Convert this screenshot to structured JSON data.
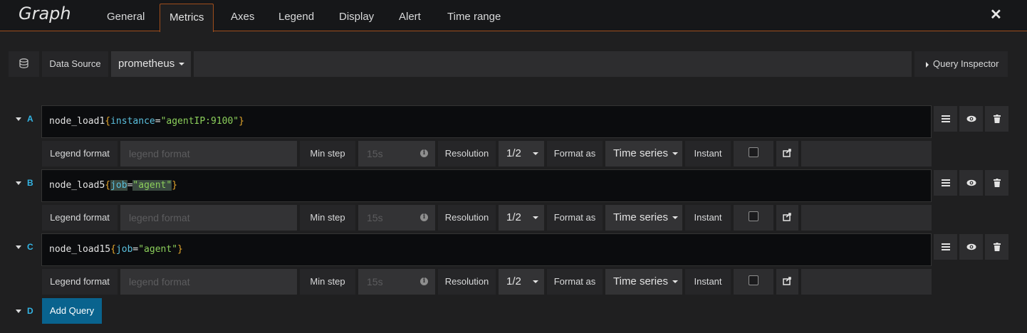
{
  "panel": {
    "title": "Graph",
    "tabs": [
      "General",
      "Metrics",
      "Axes",
      "Legend",
      "Display",
      "Alert",
      "Time range"
    ],
    "active_tab": "Metrics"
  },
  "datasource": {
    "label": "Data Source",
    "value": "prometheus",
    "inspector_label": "Query Inspector"
  },
  "queries": [
    {
      "ref": "A",
      "metric": "node_load1",
      "label_key": "instance",
      "label_value": "\"agentIP:9100\""
    },
    {
      "ref": "B",
      "metric": "node_load5",
      "label_key": "job",
      "label_value": "\"agent\""
    },
    {
      "ref": "C",
      "metric": "node_load15",
      "label_key": "job",
      "label_value": "\"agent\""
    }
  ],
  "options": {
    "legend_label": "Legend format",
    "legend_placeholder": "legend format",
    "min_step_label": "Min step",
    "min_step_placeholder": "15s",
    "resolution_label": "Resolution",
    "resolution_value": "1/2",
    "format_label": "Format as",
    "format_value": "Time series",
    "instant_label": "Instant"
  },
  "add_query": {
    "ref": "D",
    "label": "Add Query"
  },
  "icons": {
    "database": "database-icon",
    "menu": "hamburger-icon",
    "eye": "eye-icon",
    "trash": "trash-icon",
    "share": "external-link-icon",
    "close": "close-icon"
  },
  "colors": {
    "accent_border": "#a04e1c",
    "ref_letter": "#33b5e5",
    "primary_button": "#09638e"
  }
}
